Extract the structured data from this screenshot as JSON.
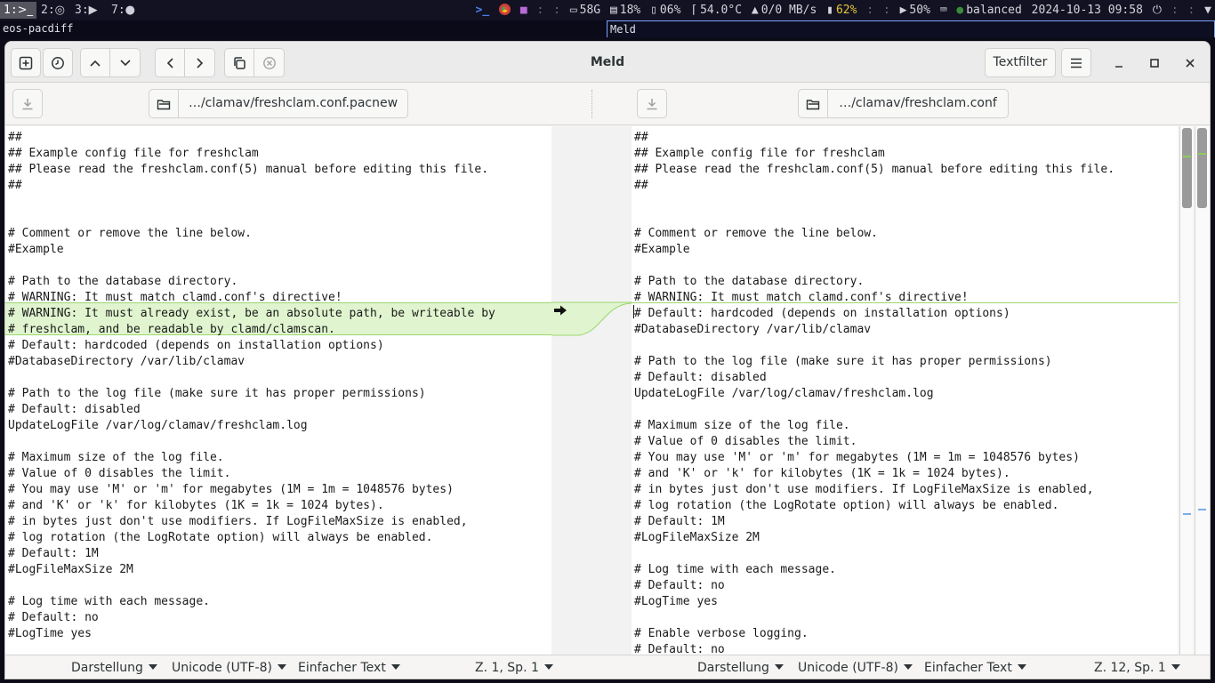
{
  "sysbar": {
    "workspaces": [
      {
        "label": "1:",
        "icon": ">_"
      },
      {
        "label": "2:",
        "icon": "◎"
      },
      {
        "label": "3:",
        "icon": "▶"
      },
      {
        "label": "7:",
        "icon": "●"
      }
    ],
    "disk": "58G",
    "mem": "18%",
    "swap": "06%",
    "temp": "54.0°C",
    "net": "0/0 MB/s",
    "battery": "62%",
    "volume": "50%",
    "power_profile": "balanced",
    "datetime": "2024-10-13 09:58"
  },
  "tabs": {
    "left": "eos-pacdiff",
    "right": "Meld"
  },
  "headerbar": {
    "title": "Meld",
    "textfilter_label": "Textfilter"
  },
  "files": {
    "left_path": "…/clamav/freshclam.conf.pacnew",
    "right_path": "…/clamav/freshclam.conf"
  },
  "left_lines": [
    "##",
    "## Example config file for freshclam",
    "## Please read the freshclam.conf(5) manual before editing this file.",
    "##",
    "",
    "",
    "# Comment or remove the line below.",
    "#Example",
    "",
    "# Path to the database directory.",
    "# WARNING: It must match clamd.conf's directive!",
    "# WARNING: It must already exist, be an absolute path, be writeable by",
    "# freshclam, and be readable by clamd/clamscan.",
    "# Default: hardcoded (depends on installation options)",
    "#DatabaseDirectory /var/lib/clamav",
    "",
    "# Path to the log file (make sure it has proper permissions)",
    "# Default: disabled",
    "UpdateLogFile /var/log/clamav/freshclam.log",
    "",
    "# Maximum size of the log file.",
    "# Value of 0 disables the limit.",
    "# You may use 'M' or 'm' for megabytes (1M = 1m = 1048576 bytes)",
    "# and 'K' or 'k' for kilobytes (1K = 1k = 1024 bytes).",
    "# in bytes just don't use modifiers. If LogFileMaxSize is enabled,",
    "# log rotation (the LogRotate option) will always be enabled.",
    "# Default: 1M",
    "#LogFileMaxSize 2M",
    "",
    "# Log time with each message.",
    "# Default: no",
    "#LogTime yes"
  ],
  "right_lines": [
    "##",
    "## Example config file for freshclam",
    "## Please read the freshclam.conf(5) manual before editing this file.",
    "##",
    "",
    "",
    "# Comment or remove the line below.",
    "#Example",
    "",
    "# Path to the database directory.",
    "# WARNING: It must match clamd.conf's directive!",
    "# Default: hardcoded (depends on installation options)",
    "#DatabaseDirectory /var/lib/clamav",
    "",
    "# Path to the log file (make sure it has proper permissions)",
    "# Default: disabled",
    "UpdateLogFile /var/log/clamav/freshclam.log",
    "",
    "# Maximum size of the log file.",
    "# Value of 0 disables the limit.",
    "# You may use 'M' or 'm' for megabytes (1M = 1m = 1048576 bytes)",
    "# and 'K' or 'k' for kilobytes (1K = 1k = 1024 bytes).",
    "# in bytes just don't use modifiers. If LogFileMaxSize is enabled,",
    "# log rotation (the LogRotate option) will always be enabled.",
    "# Default: 1M",
    "#LogFileMaxSize 2M",
    "",
    "# Log time with each message.",
    "# Default: no",
    "#LogTime yes",
    "",
    "# Enable verbose logging.",
    "# Default: no"
  ],
  "statusbar": {
    "left": {
      "view": "Darstellung",
      "encoding": "Unicode (UTF-8)",
      "syntax": "Einfacher Text",
      "position": "Z. 1, Sp. 1"
    },
    "right": {
      "view": "Darstellung",
      "encoding": "Unicode (UTF-8)",
      "syntax": "Einfacher Text",
      "position": "Z. 12, Sp. 1"
    }
  },
  "colors": {
    "insert_bg": "#e0f5cf",
    "insert_border": "#9bd66f",
    "scroll_mark_green": "#8ccf5b",
    "scroll_mark_blue": "#7aaee8"
  }
}
